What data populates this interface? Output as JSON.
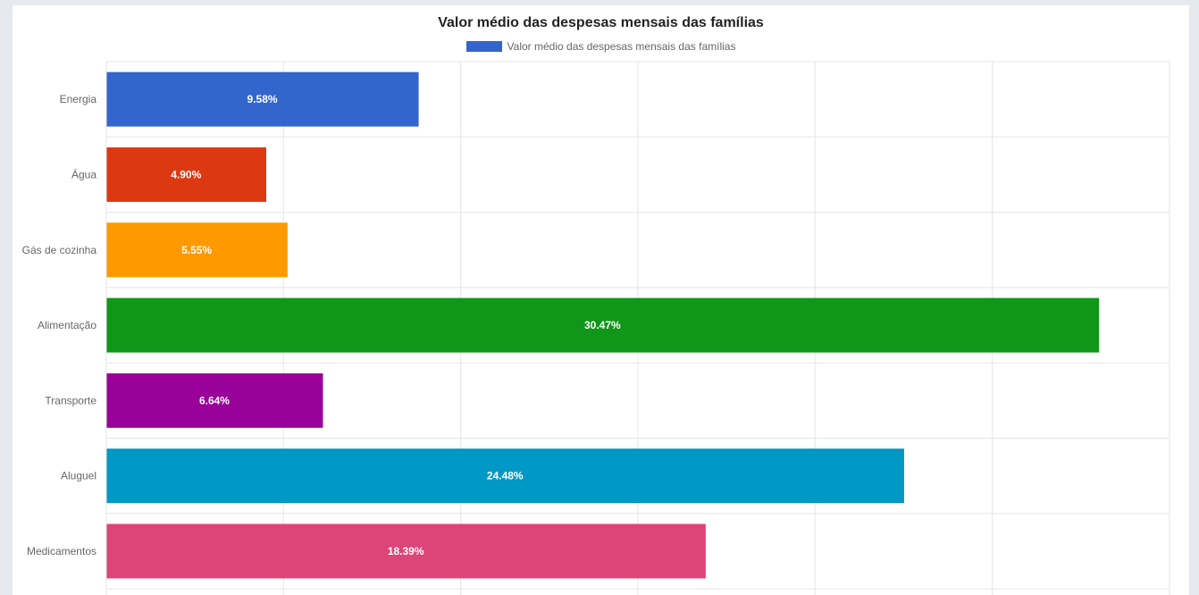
{
  "colors": {
    "grid": "#e5e5e5",
    "label_text": "#666666",
    "bar_label_text": "#ffffff"
  },
  "chart_data": {
    "type": "bar",
    "orientation": "horizontal",
    "title": "Valor médio das despesas mensais das famílias",
    "legend": {
      "placement": "top-center",
      "label": "Valor médio das despesas mensais das famílias",
      "color": "#3366cc"
    },
    "grid": true,
    "xlim": [
      0,
      30
    ],
    "xtick_step": 5,
    "value_labels": [
      "9.58%",
      "4.90%",
      "5.55%",
      "30.47%",
      "6.64%",
      "24.48%",
      "18.39%"
    ],
    "categories": [
      "Energia",
      "Água",
      "Gás de cozinha",
      "Alimentação",
      "Transporte",
      "Aluguel",
      "Medicamentos"
    ],
    "values": [
      8.8,
      4.5,
      5.1,
      28.0,
      6.1,
      22.5,
      16.9
    ],
    "bar_colors": [
      "#3366cc",
      "#dc3912",
      "#ff9900",
      "#109618",
      "#990099",
      "#0099c6",
      "#dd4477"
    ]
  }
}
